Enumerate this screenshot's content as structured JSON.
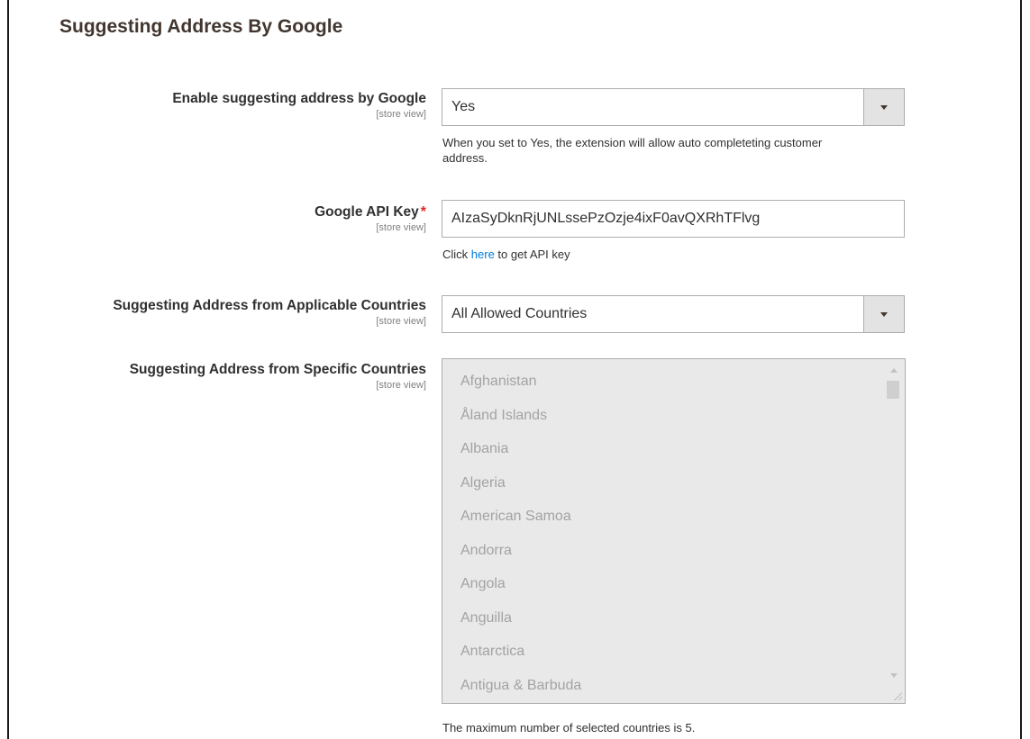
{
  "section": {
    "title": "Suggesting Address By Google"
  },
  "enable": {
    "label": "Enable suggesting address by Google",
    "scope": "[store view]",
    "value": "Yes",
    "note": "When you set to Yes, the extension will allow auto completeting customer address."
  },
  "api_key": {
    "label": "Google API Key",
    "required_mark": "*",
    "scope": "[store view]",
    "value": "AIzaSyDknRjUNLssePzOzje4ixF0avQXRhTFlvg",
    "note_prefix": "Click ",
    "note_link": "here",
    "note_suffix": " to get API key"
  },
  "applicable": {
    "label": "Suggesting Address from Applicable Countries",
    "scope": "[store view]",
    "value": "All Allowed Countries"
  },
  "specific": {
    "label": "Suggesting Address from Specific Countries",
    "scope": "[store view]",
    "countries": [
      "Afghanistan",
      "Åland Islands",
      "Albania",
      "Algeria",
      "American Samoa",
      "Andorra",
      "Angola",
      "Anguilla",
      "Antarctica",
      "Antigua & Barbuda"
    ],
    "note": "The maximum number of selected countries is 5."
  },
  "colors": {
    "link": "#007bdb",
    "required": "#e22626",
    "disabled_bg": "#e9e9e9"
  },
  "icons": {
    "dropdown": "chevron-down-icon"
  }
}
